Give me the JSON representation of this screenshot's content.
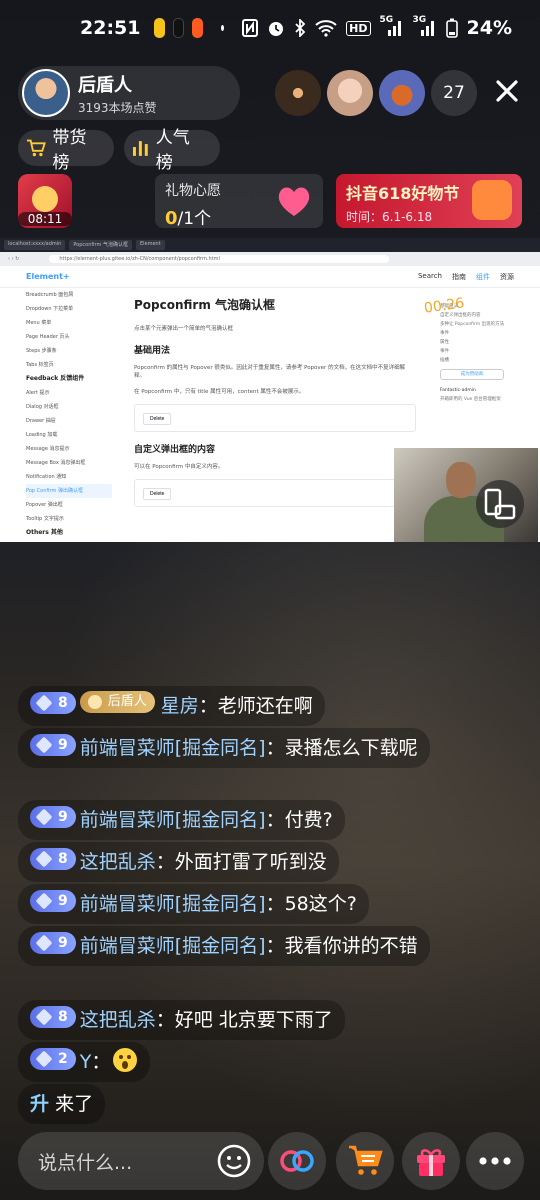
{
  "status": {
    "time": "22:51",
    "battery": "24%",
    "hd": "HD",
    "net5g": "5G",
    "net3g": "3G"
  },
  "host": {
    "name": "后盾人",
    "likes": "3193本场点赞"
  },
  "viewers": {
    "count": "27"
  },
  "pills": {
    "goods": "带货榜",
    "popular": "人气榜"
  },
  "redpacket": {
    "timer": "08:11"
  },
  "wish": {
    "title": "礼物心愿",
    "current": "0",
    "total": "/1个"
  },
  "promo": {
    "title": "抖音618好物节",
    "time": "时间：6.1-6.18"
  },
  "screen": {
    "tabs": [
      "localhost:xxxx/admin",
      "Popconfirm 气泡确认框",
      "Element"
    ],
    "url": "https://element-plus.gitee.io/zh-CN/component/popconfirm.html",
    "logo": "Element+",
    "search": "Search",
    "nav": [
      "指南",
      "组件",
      "资源"
    ],
    "sidebar_group": "Feedback 反馈组件",
    "sidebar_top": [
      "Breadcrumb 面包屑",
      "Dropdown 下拉菜单",
      "Menu 菜单",
      "Page Header 页头",
      "Steps 步骤条",
      "Tabs 标签页"
    ],
    "sidebar_items": [
      "Alert 提示",
      "Dialog 对话框",
      "Drawer 抽屉",
      "Loading 加载",
      "Message 消息提示",
      "Message Box 消息弹出框",
      "Notification 通知"
    ],
    "sidebar_active": "Pop Confirm 弹出确认框",
    "sidebar_after": [
      "Popover 弹出框",
      "Tooltip 文字提示"
    ],
    "sidebar_others": "Others 其他",
    "title": "Popconfirm 气泡确认框",
    "desc": "点击某个元素弹出一个简单的气泡确认框",
    "section1": "基础用法",
    "p1": "Popconfirm 的属性与 Popover 很类似。因此对于重复属性，请参考 Popover 的文档，在这文档中不复详细解释。",
    "p2": "在 Popconfirm 中，只有 title 属性可用，content 属性不会被展示。",
    "delete": "Delete",
    "section2": "自定义弹出框的内容",
    "p3": "可以在 Popconfirm 中自定义内容。",
    "toc": [
      "基础用法",
      "自定义弹出框的内容",
      "多种让 Popconfirm 出现的方法",
      "事件",
      "属性",
      "事件",
      "插槽"
    ],
    "overlay_timer": "00:26",
    "sponsor": "成为赞助商",
    "ad_title": "Fantastic-admin",
    "ad_sub": "开箱即用的 Vue 后台管理框架"
  },
  "messages": [
    {
      "level": "8",
      "fan": "后盾人",
      "user": "星房",
      "text": "：老师还在啊"
    },
    {
      "level": "9",
      "user": "前端冒菜师[掘金同名]",
      "text": "：录播怎么下载呢"
    },
    {
      "level": "9",
      "user": "前端冒菜师[掘金同名]",
      "text": "：付费?"
    },
    {
      "level": "8",
      "user": "这把乱杀",
      "text": "：外面打雷了听到没"
    },
    {
      "level": "9",
      "user": "前端冒菜师[掘金同名]",
      "text": "：58这个?"
    },
    {
      "level": "9",
      "user": "前端冒菜师[掘金同名]",
      "text": "：我看你讲的不错"
    },
    {
      "level": "8",
      "user": "这把乱杀",
      "text": "：好吧 北京要下雨了"
    },
    {
      "level": "2",
      "user": "Y",
      "text": "："
    }
  ],
  "upgrade": {
    "icon": "升",
    "text": "来了"
  },
  "input": {
    "placeholder": "说点什么..."
  },
  "icons": [
    "emoji-icon",
    "link-icon",
    "cart-icon",
    "gift-icon",
    "more-icon"
  ],
  "colors": {
    "accent": "#ffcc33",
    "user": "#9fd2ff",
    "level": "#6a82f0",
    "promo": "#d42a40"
  }
}
